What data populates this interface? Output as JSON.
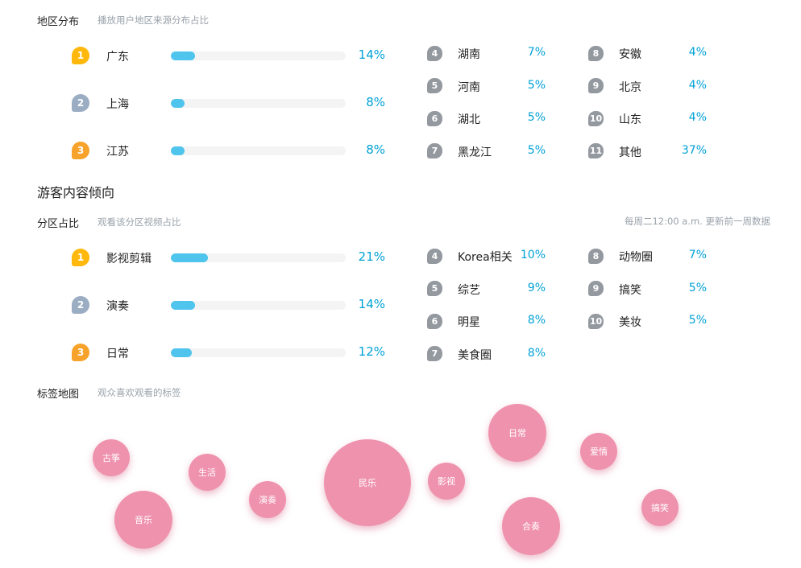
{
  "region": {
    "title": "地区分布",
    "subtitle": "播放用户地区来源分布占比",
    "top": [
      {
        "rank": "1",
        "name": "广东",
        "pct": "14%",
        "value": 0.14,
        "color": "#ffb80b"
      },
      {
        "rank": "2",
        "name": "上海",
        "pct": "8%",
        "value": 0.08,
        "color": "#9aadc2"
      },
      {
        "rank": "3",
        "name": "江苏",
        "pct": "8%",
        "value": 0.08,
        "color": "#f7a32b"
      }
    ],
    "rest_col1": [
      {
        "rank": "4",
        "name": "湖南",
        "pct": "7%"
      },
      {
        "rank": "5",
        "name": "河南",
        "pct": "5%"
      },
      {
        "rank": "6",
        "name": "湖北",
        "pct": "5%"
      },
      {
        "rank": "7",
        "name": "黑龙江",
        "pct": "5%"
      }
    ],
    "rest_col2": [
      {
        "rank": "8",
        "name": "安徽",
        "pct": "4%"
      },
      {
        "rank": "9",
        "name": "北京",
        "pct": "4%"
      },
      {
        "rank": "10",
        "name": "山东",
        "pct": "4%"
      },
      {
        "rank": "11",
        "name": "其他",
        "pct": "37%"
      }
    ]
  },
  "content_title": "游客内容倾向",
  "zone": {
    "title": "分区占比",
    "subtitle": "观看该分区视频占比",
    "note": "每周二12:00 a.m. 更新前一周数据",
    "top": [
      {
        "rank": "1",
        "name": "影视剪辑",
        "pct": "21%",
        "value": 0.21,
        "color": "#ffb80b"
      },
      {
        "rank": "2",
        "name": "演奏",
        "pct": "14%",
        "value": 0.14,
        "color": "#9aadc2"
      },
      {
        "rank": "3",
        "name": "日常",
        "pct": "12%",
        "value": 0.12,
        "color": "#f7a32b"
      }
    ],
    "rest_col1": [
      {
        "rank": "4",
        "name": "Korea相关",
        "pct": "10%"
      },
      {
        "rank": "5",
        "name": "综艺",
        "pct": "9%"
      },
      {
        "rank": "6",
        "name": "明星",
        "pct": "8%"
      },
      {
        "rank": "7",
        "name": "美食圈",
        "pct": "8%"
      }
    ],
    "rest_col2": [
      {
        "rank": "8",
        "name": "动物圈",
        "pct": "7%"
      },
      {
        "rank": "9",
        "name": "搞笑",
        "pct": "5%"
      },
      {
        "rank": "10",
        "name": "美妆",
        "pct": "5%"
      }
    ]
  },
  "tags": {
    "title": "标签地图",
    "subtitle": "观众喜欢观看的标签",
    "bubbles": [
      "古筝",
      "音乐",
      "生活",
      "演奏",
      "民乐",
      "影视",
      "日常",
      "合奏",
      "爱情",
      "搞笑"
    ]
  },
  "colors": {
    "accent": "#00a1d6",
    "bar": "#4fc4ec",
    "badge_grey": "#9499a0",
    "bubble": "#ef92ad"
  }
}
